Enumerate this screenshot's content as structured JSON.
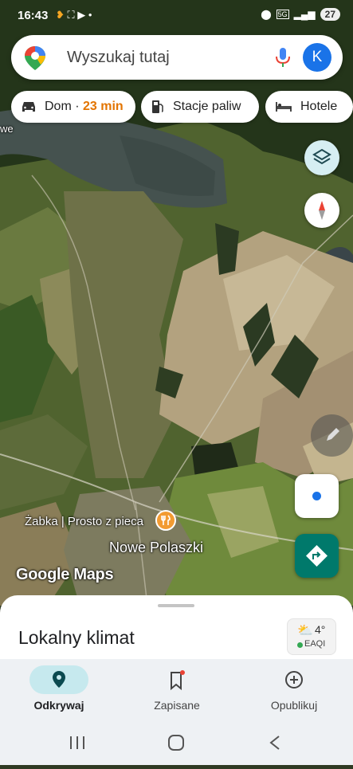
{
  "status_bar": {
    "time": "16:43",
    "network": "5G",
    "battery": "27"
  },
  "search": {
    "placeholder": "Wyszukaj tutaj",
    "avatar_letter": "K"
  },
  "chips": {
    "home_label": "Dom",
    "home_separator": " · ",
    "home_time": "23 min",
    "fuel_label": "Stacje paliw",
    "hotels_label": "Hotele"
  },
  "map": {
    "place_label": "Żabka | Prosto z pieca",
    "town_label": "Nowe Polaszki",
    "watermark": "Google Maps",
    "edge_text": "we"
  },
  "sheet": {
    "title": "Lokalny klimat",
    "temperature": "4°",
    "aqi_label": "EAQI"
  },
  "bottom_nav": {
    "explore": "Odkrywaj",
    "saved": "Zapisane",
    "contribute": "Opublikuj"
  },
  "colors": {
    "accent_teal": "#00796b",
    "location_blue": "#1a73e8",
    "eta_orange": "#e37400"
  }
}
